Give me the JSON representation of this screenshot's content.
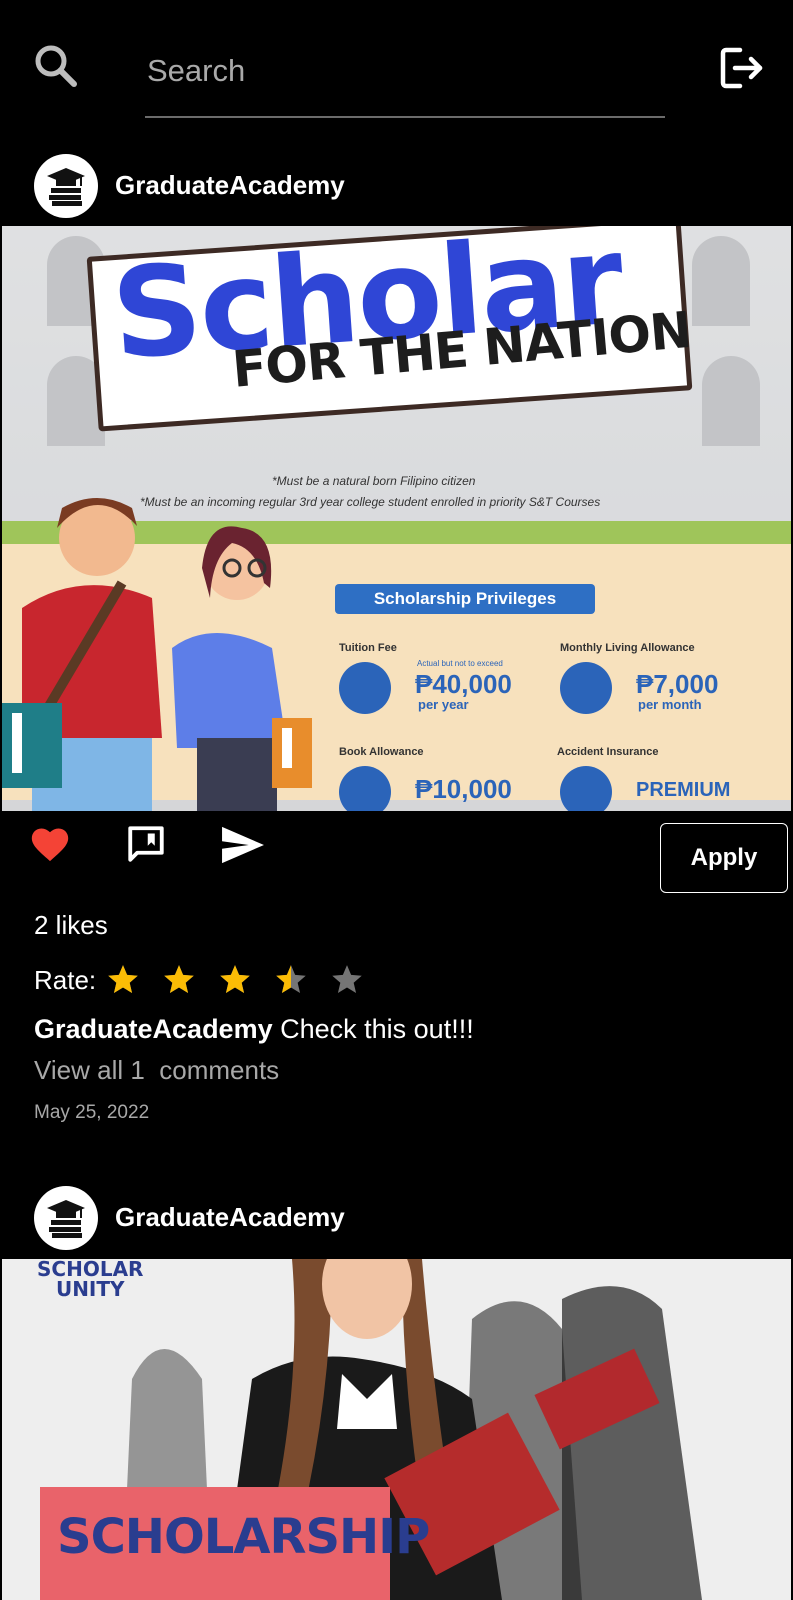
{
  "search": {
    "placeholder": "Search"
  },
  "icons": {
    "search": "search-icon",
    "logout": "logout-icon",
    "like": "heart-icon",
    "comment": "comment-icon",
    "share": "send-icon",
    "star": "star-icon"
  },
  "colors": {
    "background": "#000000",
    "like": "#f44336",
    "star_filled": "#fbbc05",
    "star_empty": "#757575",
    "muted_text": "#a8a8a8"
  },
  "posts": [
    {
      "username": "GraduateAcademy",
      "image": {
        "title": "Scholar",
        "subtitle": "FOR THE NATION",
        "note1": "*Must be a natural born Filipino citizen",
        "note2": "*Must be an incoming regular 3rd year college student enrolled in priority S&T Courses",
        "tag": "Scholarship Privileges",
        "items": [
          {
            "label": "Tuition Fee",
            "tiny": "Actual but not to exceed",
            "value": "₱40,000",
            "sub": "per year"
          },
          {
            "label": "Monthly Living Allowance",
            "value": "₱7,000",
            "sub": "per month"
          },
          {
            "label": "Book Allowance",
            "value": "₱10,000"
          },
          {
            "label": "Accident Insurance",
            "value": "PREMIUM"
          }
        ]
      },
      "apply_label": "Apply",
      "likes": "2 likes",
      "rate_label": "Rate:",
      "rating": 3.5,
      "rating_max": 5,
      "caption_user": "GraduateAcademy",
      "caption_text": " Check this out!!!",
      "comments_link": "View all 1  comments",
      "date": "May 25, 2022"
    },
    {
      "username": "GraduateAcademy",
      "image": {
        "brand_line1": "SCHOLAR",
        "brand_line2": "UNITY",
        "sign": "SCHOLARSHIP"
      }
    }
  ]
}
